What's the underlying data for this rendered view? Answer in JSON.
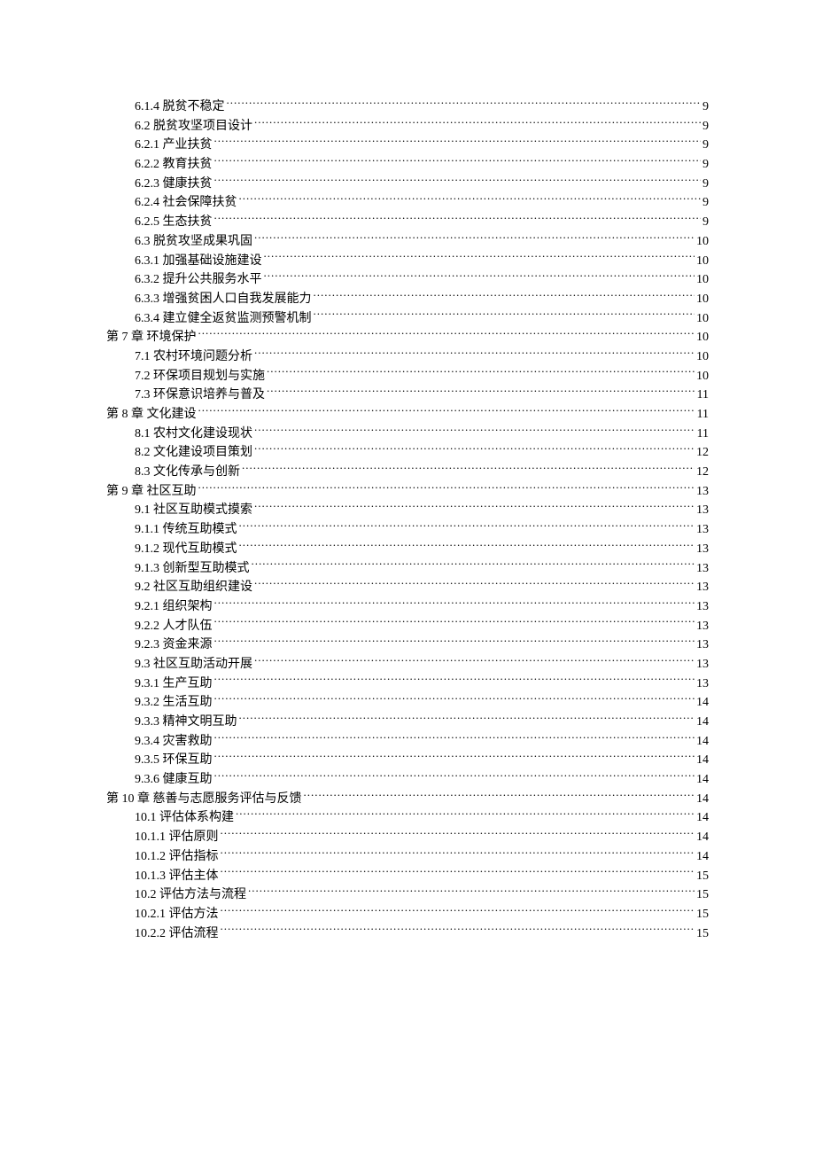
{
  "toc": [
    {
      "indent": 1,
      "title": "6.1.4 脱贫不稳定",
      "page": "9"
    },
    {
      "indent": 1,
      "title": "6.2 脱贫攻坚项目设计",
      "page": "9"
    },
    {
      "indent": 1,
      "title": "6.2.1 产业扶贫",
      "page": "9"
    },
    {
      "indent": 1,
      "title": "6.2.2 教育扶贫",
      "page": "9"
    },
    {
      "indent": 1,
      "title": "6.2.3 健康扶贫",
      "page": "9"
    },
    {
      "indent": 1,
      "title": "6.2.4 社会保障扶贫",
      "page": "9"
    },
    {
      "indent": 1,
      "title": "6.2.5 生态扶贫",
      "page": "9"
    },
    {
      "indent": 1,
      "title": "6.3 脱贫攻坚成果巩固",
      "page": "10"
    },
    {
      "indent": 1,
      "title": "6.3.1 加强基础设施建设",
      "page": "10"
    },
    {
      "indent": 1,
      "title": "6.3.2 提升公共服务水平",
      "page": "10"
    },
    {
      "indent": 1,
      "title": "6.3.3 增强贫困人口自我发展能力",
      "page": "10"
    },
    {
      "indent": 1,
      "title": "6.3.4 建立健全返贫监测预警机制",
      "page": "10"
    },
    {
      "indent": 0,
      "title": "第 7 章 环境保护 ",
      "page": "10"
    },
    {
      "indent": 1,
      "title": "7.1 农村环境问题分析",
      "page": "10"
    },
    {
      "indent": 1,
      "title": "7.2 环保项目规划与实施",
      "page": "10"
    },
    {
      "indent": 1,
      "title": "7.3 环保意识培养与普及",
      "page": "11"
    },
    {
      "indent": 0,
      "title": "第 8 章 文化建设 ",
      "page": "11"
    },
    {
      "indent": 1,
      "title": "8.1 农村文化建设现状",
      "page": "11"
    },
    {
      "indent": 1,
      "title": "8.2 文化建设项目策划",
      "page": "12"
    },
    {
      "indent": 1,
      "title": "8.3 文化传承与创新",
      "page": "12"
    },
    {
      "indent": 0,
      "title": "第 9 章 社区互助 ",
      "page": "13"
    },
    {
      "indent": 1,
      "title": "9.1 社区互助模式摸索",
      "page": "13"
    },
    {
      "indent": 1,
      "title": "9.1.1 传统互助模式",
      "page": "13"
    },
    {
      "indent": 1,
      "title": "9.1.2 现代互助模式",
      "page": "13"
    },
    {
      "indent": 1,
      "title": "9.1.3 创新型互助模式",
      "page": "13"
    },
    {
      "indent": 1,
      "title": "9.2 社区互助组织建设",
      "page": "13"
    },
    {
      "indent": 1,
      "title": "9.2.1 组织架构",
      "page": "13"
    },
    {
      "indent": 1,
      "title": "9.2.2 人才队伍 ",
      "page": "13"
    },
    {
      "indent": 1,
      "title": "9.2.3 资金来源 ",
      "page": "13"
    },
    {
      "indent": 1,
      "title": "9.3 社区互助活动开展",
      "page": "13"
    },
    {
      "indent": 1,
      "title": "9.3.1 生产互助 ",
      "page": "13"
    },
    {
      "indent": 1,
      "title": "9.3.2 生活互助 ",
      "page": "14"
    },
    {
      "indent": 1,
      "title": "9.3.3 精神文明互助",
      "page": "14"
    },
    {
      "indent": 1,
      "title": "9.3.4 灾害救助 ",
      "page": "14"
    },
    {
      "indent": 1,
      "title": "9.3.5 环保互助 ",
      "page": "14"
    },
    {
      "indent": 1,
      "title": "9.3.6 健康互助 ",
      "page": "14"
    },
    {
      "indent": 0,
      "title": "第 10 章 慈善与志愿服务评估与反馈",
      "page": "14"
    },
    {
      "indent": 1,
      "title": "10.1 评估体系构建",
      "page": "14"
    },
    {
      "indent": 1,
      "title": "10.1.1 评估原则",
      "page": "14"
    },
    {
      "indent": 1,
      "title": "10.1.2 评估指标",
      "page": "14"
    },
    {
      "indent": 1,
      "title": "10.1.3 评估主体",
      "page": "15"
    },
    {
      "indent": 1,
      "title": "10.2 评估方法与流程",
      "page": "15"
    },
    {
      "indent": 1,
      "title": "10.2.1 评估方法",
      "page": "15"
    },
    {
      "indent": 1,
      "title": "10.2.2 评估流程",
      "page": "15"
    }
  ]
}
